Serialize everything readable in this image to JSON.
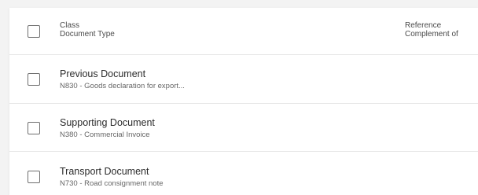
{
  "table": {
    "header": {
      "class_label": "Class",
      "document_type_label": "Document Type",
      "reference_label": "Reference",
      "complement_label": "Complement of"
    },
    "rows": [
      {
        "class": "Previous Document",
        "document_type": "N830 - Goods declaration for export..."
      },
      {
        "class": "Supporting Document",
        "document_type": "N380 - Commercial Invoice"
      },
      {
        "class": "Transport Document",
        "document_type": "N730 - Road consignment note"
      }
    ]
  },
  "colors": {
    "background": "#f3f3f3",
    "panel": "#ffffff",
    "divider": "#e6e6e6",
    "primary_text": "#2b2b2b",
    "secondary_text": "#666666"
  }
}
